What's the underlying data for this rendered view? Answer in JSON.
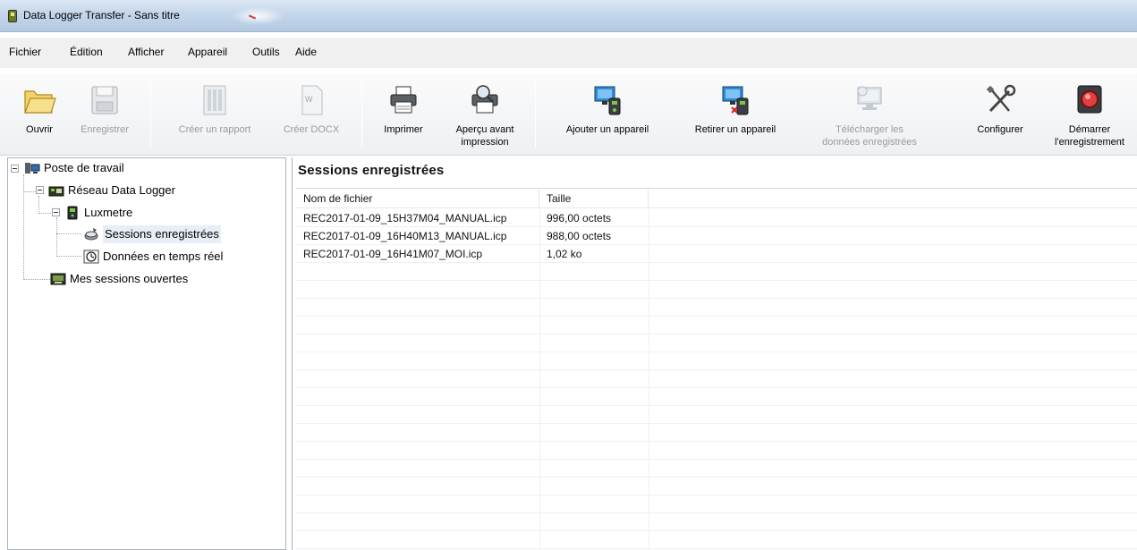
{
  "window": {
    "title": "Data Logger Transfer - Sans titre"
  },
  "menu": [
    "Fichier",
    "Édition",
    "Afficher",
    "Appareil",
    "Outils",
    "Aide"
  ],
  "toolbar": {
    "open": "Ouvrir",
    "save": "Enregistrer",
    "create_report": "Créer un rapport",
    "create_docx": "Créer DOCX",
    "print": "Imprimer",
    "preview_1": "Aperçu avant",
    "preview_2": "impression",
    "add_device": "Ajouter un appareil",
    "remove_device": "Retirer un appareil",
    "download_1": "Télécharger les",
    "download_2": "données enregistrées",
    "configure": "Configurer",
    "start_1": "Démarrer",
    "start_2": "l'enregistrement"
  },
  "tree": {
    "root": "Poste de travail",
    "network": "Réseau Data Logger",
    "device": "Luxmetre",
    "sessions": "Sessions enregistrées",
    "realtime": "Données en temps réel",
    "open_sessions": "Mes sessions ouvertes"
  },
  "sessions": {
    "title": "Sessions enregistrées",
    "columns": [
      "Nom de fichier",
      "Taille"
    ],
    "rows": [
      {
        "name": "REC2017-01-09_15H37M04_MANUAL.icp",
        "size": "996,00 octets"
      },
      {
        "name": "REC2017-01-09_16H40M13_MANUAL.icp",
        "size": "988,00 octets"
      },
      {
        "name": "REC2017-01-09_16H41M07_MOI.icp",
        "size": "1,02 ko"
      }
    ]
  },
  "colors": {
    "titlebar": "#c4d6ea",
    "menubar": "#f0f0f0",
    "disabled_text": "#9a9a9a",
    "start_button_red": "#c42020"
  }
}
